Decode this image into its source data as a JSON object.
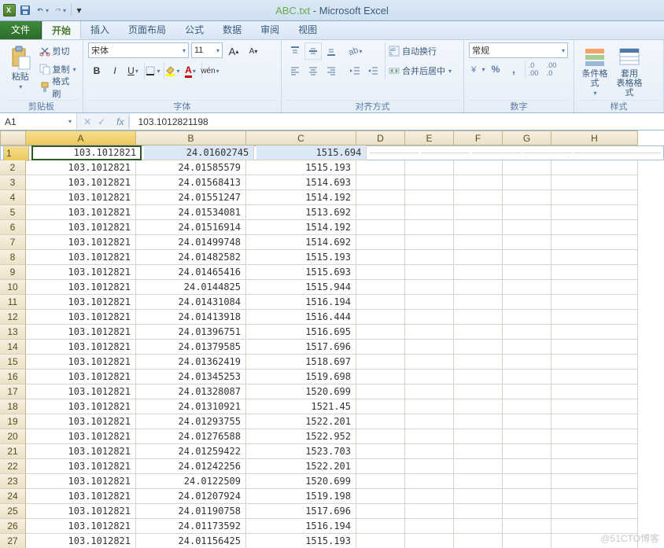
{
  "title": {
    "filename": "ABC.txt",
    "app": "Microsoft Excel"
  },
  "qat": {
    "save": "save-icon",
    "undo": "undo-icon",
    "redo": "redo-icon"
  },
  "tabs": {
    "file": "文件",
    "items": [
      "开始",
      "插入",
      "页面布局",
      "公式",
      "数据",
      "审阅",
      "视图"
    ],
    "active": 0
  },
  "ribbon": {
    "clipboard": {
      "paste": "粘贴",
      "cut": "剪切",
      "copy": "复制",
      "format_painter": "格式刷",
      "label": "剪贴板"
    },
    "font": {
      "name": "宋体",
      "size": "11",
      "label": "字体"
    },
    "align": {
      "wrap": "自动换行",
      "merge": "合并后居中",
      "label": "对齐方式"
    },
    "number": {
      "format": "常规",
      "label": "数字"
    },
    "styles": {
      "cond": "条件格式",
      "table": "套用\n表格格式",
      "label": "样式"
    }
  },
  "formula_bar": {
    "cell_ref": "A1",
    "fx": "fx",
    "value": "103.1012821198"
  },
  "columns": [
    "A",
    "B",
    "C",
    "D",
    "E",
    "F",
    "G",
    "H"
  ],
  "col_widths": [
    "wA",
    "wB",
    "wC",
    "wD",
    "wE",
    "wF",
    "wG",
    "wH"
  ],
  "active_cell": {
    "row": 1,
    "col": "A"
  },
  "rows": [
    {
      "n": 1,
      "A": "103.1012821",
      "B": "24.01602745",
      "C": "1515.694"
    },
    {
      "n": 2,
      "A": "103.1012821",
      "B": "24.01585579",
      "C": "1515.193"
    },
    {
      "n": 3,
      "A": "103.1012821",
      "B": "24.01568413",
      "C": "1514.693"
    },
    {
      "n": 4,
      "A": "103.1012821",
      "B": "24.01551247",
      "C": "1514.192"
    },
    {
      "n": 5,
      "A": "103.1012821",
      "B": "24.01534081",
      "C": "1513.692"
    },
    {
      "n": 6,
      "A": "103.1012821",
      "B": "24.01516914",
      "C": "1514.192"
    },
    {
      "n": 7,
      "A": "103.1012821",
      "B": "24.01499748",
      "C": "1514.692"
    },
    {
      "n": 8,
      "A": "103.1012821",
      "B": "24.01482582",
      "C": "1515.193"
    },
    {
      "n": 9,
      "A": "103.1012821",
      "B": "24.01465416",
      "C": "1515.693"
    },
    {
      "n": 10,
      "A": "103.1012821",
      "B": "24.0144825",
      "C": "1515.944"
    },
    {
      "n": 11,
      "A": "103.1012821",
      "B": "24.01431084",
      "C": "1516.194"
    },
    {
      "n": 12,
      "A": "103.1012821",
      "B": "24.01413918",
      "C": "1516.444"
    },
    {
      "n": 13,
      "A": "103.1012821",
      "B": "24.01396751",
      "C": "1516.695"
    },
    {
      "n": 14,
      "A": "103.1012821",
      "B": "24.01379585",
      "C": "1517.696"
    },
    {
      "n": 15,
      "A": "103.1012821",
      "B": "24.01362419",
      "C": "1518.697"
    },
    {
      "n": 16,
      "A": "103.1012821",
      "B": "24.01345253",
      "C": "1519.698"
    },
    {
      "n": 17,
      "A": "103.1012821",
      "B": "24.01328087",
      "C": "1520.699"
    },
    {
      "n": 18,
      "A": "103.1012821",
      "B": "24.01310921",
      "C": "1521.45"
    },
    {
      "n": 19,
      "A": "103.1012821",
      "B": "24.01293755",
      "C": "1522.201"
    },
    {
      "n": 20,
      "A": "103.1012821",
      "B": "24.01276588",
      "C": "1522.952"
    },
    {
      "n": 21,
      "A": "103.1012821",
      "B": "24.01259422",
      "C": "1523.703"
    },
    {
      "n": 22,
      "A": "103.1012821",
      "B": "24.01242256",
      "C": "1522.201"
    },
    {
      "n": 23,
      "A": "103.1012821",
      "B": "24.0122509",
      "C": "1520.699"
    },
    {
      "n": 24,
      "A": "103.1012821",
      "B": "24.01207924",
      "C": "1519.198"
    },
    {
      "n": 25,
      "A": "103.1012821",
      "B": "24.01190758",
      "C": "1517.696"
    },
    {
      "n": 26,
      "A": "103.1012821",
      "B": "24.01173592",
      "C": "1516.194"
    },
    {
      "n": 27,
      "A": "103.1012821",
      "B": "24.01156425",
      "C": "1515.193"
    }
  ],
  "watermark": "@51CTO博客"
}
